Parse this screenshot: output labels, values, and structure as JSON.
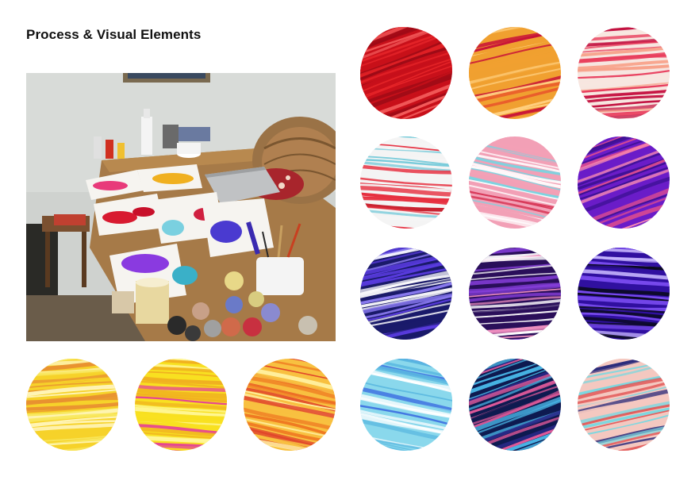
{
  "page": {
    "title": "Process & Visual Elements"
  },
  "photo": {
    "icon": "studio-table-photo"
  },
  "swatches": {
    "colors": {
      "red_1": [
        "#c8101a",
        "#e8262a",
        "#9c0a16",
        "#f25a5a"
      ],
      "orange_red": [
        "#f0a030",
        "#e8502a",
        "#c81238",
        "#ffd080"
      ],
      "pink_white": [
        "#f7e6e0",
        "#e83a5a",
        "#f7a18a",
        "#c21040"
      ],
      "red_cyan": [
        "#f4f4f4",
        "#c41020",
        "#6fc8d8",
        "#e63040"
      ],
      "pink_cyan": [
        "#f2a0b6",
        "#d83a5a",
        "#7ad4e0",
        "#ffffff"
      ],
      "purple_pink": [
        "#6a1cc8",
        "#e8508a",
        "#3a1090",
        "#ff90b0"
      ],
      "navy_violet": [
        "#1a1a6a",
        "#5a3ce0",
        "#8a7af0",
        "#ffffff"
      ],
      "violet_pink": [
        "#2a0f5a",
        "#8a40e0",
        "#f090c0",
        "#ffffff"
      ],
      "violet_black": [
        "#3010a0",
        "#7a4cf0",
        "#0a0a20",
        "#c8b8ff"
      ],
      "cyan_blue": [
        "#8ad8ec",
        "#3a6ae0",
        "#ffffff",
        "#5ab8e0"
      ],
      "navy_cyan": [
        "#0e1a50",
        "#49b8e8",
        "#e05a9a",
        "#2a2a8a"
      ],
      "multi": [
        "#f4c8c0",
        "#7ad8e0",
        "#2a2a7a",
        "#e05050"
      ],
      "yellow_1": [
        "#f6d22a",
        "#f8e860",
        "#e89030",
        "#fff6c0"
      ],
      "yellow_pink": [
        "#f8e020",
        "#e43c9a",
        "#fff8a0",
        "#f0b020"
      ],
      "orange_yellow": [
        "#f8c040",
        "#ef7a22",
        "#e0402a",
        "#fff0a0"
      ]
    }
  }
}
